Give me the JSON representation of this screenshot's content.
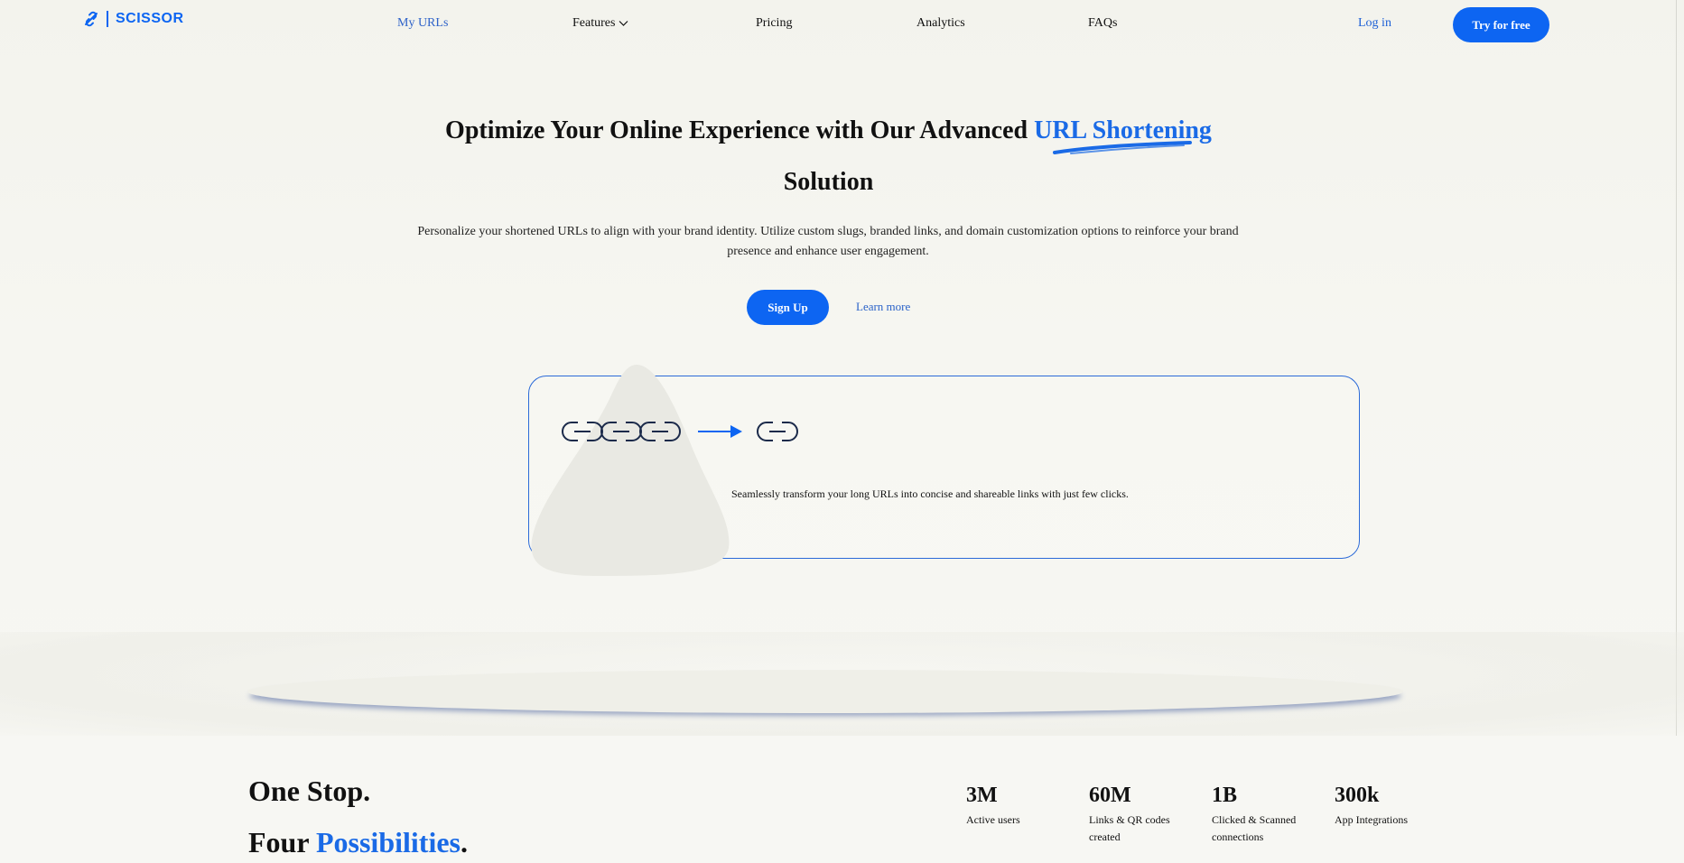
{
  "brand": {
    "name": "SCISSOR",
    "logo_icon": "link-slash-icon",
    "color": "#0d65f2"
  },
  "nav": {
    "links": [
      {
        "label": "My URLs",
        "active": true
      },
      {
        "label": "Features",
        "has_dropdown": true
      },
      {
        "label": "Pricing"
      },
      {
        "label": "Analytics"
      },
      {
        "label": "FAQs"
      }
    ],
    "login_label": "Log in",
    "cta_label": "Try for free"
  },
  "hero": {
    "title_prefix": "Optimize Your Online Experience with Our Advanced",
    "title_accent": "URL Shortening",
    "title_suffix": "Solution",
    "subtitle": "Personalize your shortened URLs to align with your brand identity. Utilize custom slugs, branded links, and domain customization options to reinforce your brand presence and enhance user engagement.",
    "signup_label": "Sign Up",
    "learn_more_label": "Learn more"
  },
  "demo": {
    "text": "Seamlessly transform your long URLs into concise and shareable links with just few clicks.",
    "icons": [
      "long-chain-icon",
      "arrow-right-icon",
      "short-link-icon"
    ]
  },
  "tagline": {
    "line1": "One Stop.",
    "line2_prefix": "Four",
    "line2_accent": "Possibilities",
    "line2_suffix": "."
  },
  "stats": [
    {
      "value": "3M",
      "label": "Active users"
    },
    {
      "value": "60M",
      "label": "Links & QR codes created"
    },
    {
      "value": "1B",
      "label": "Clicked & Scanned connections"
    },
    {
      "value": "300k",
      "label": "App Integrations"
    }
  ],
  "colors": {
    "accent": "#1a6ae6",
    "button": "#0d65f2",
    "background": "#f4f4ef"
  }
}
